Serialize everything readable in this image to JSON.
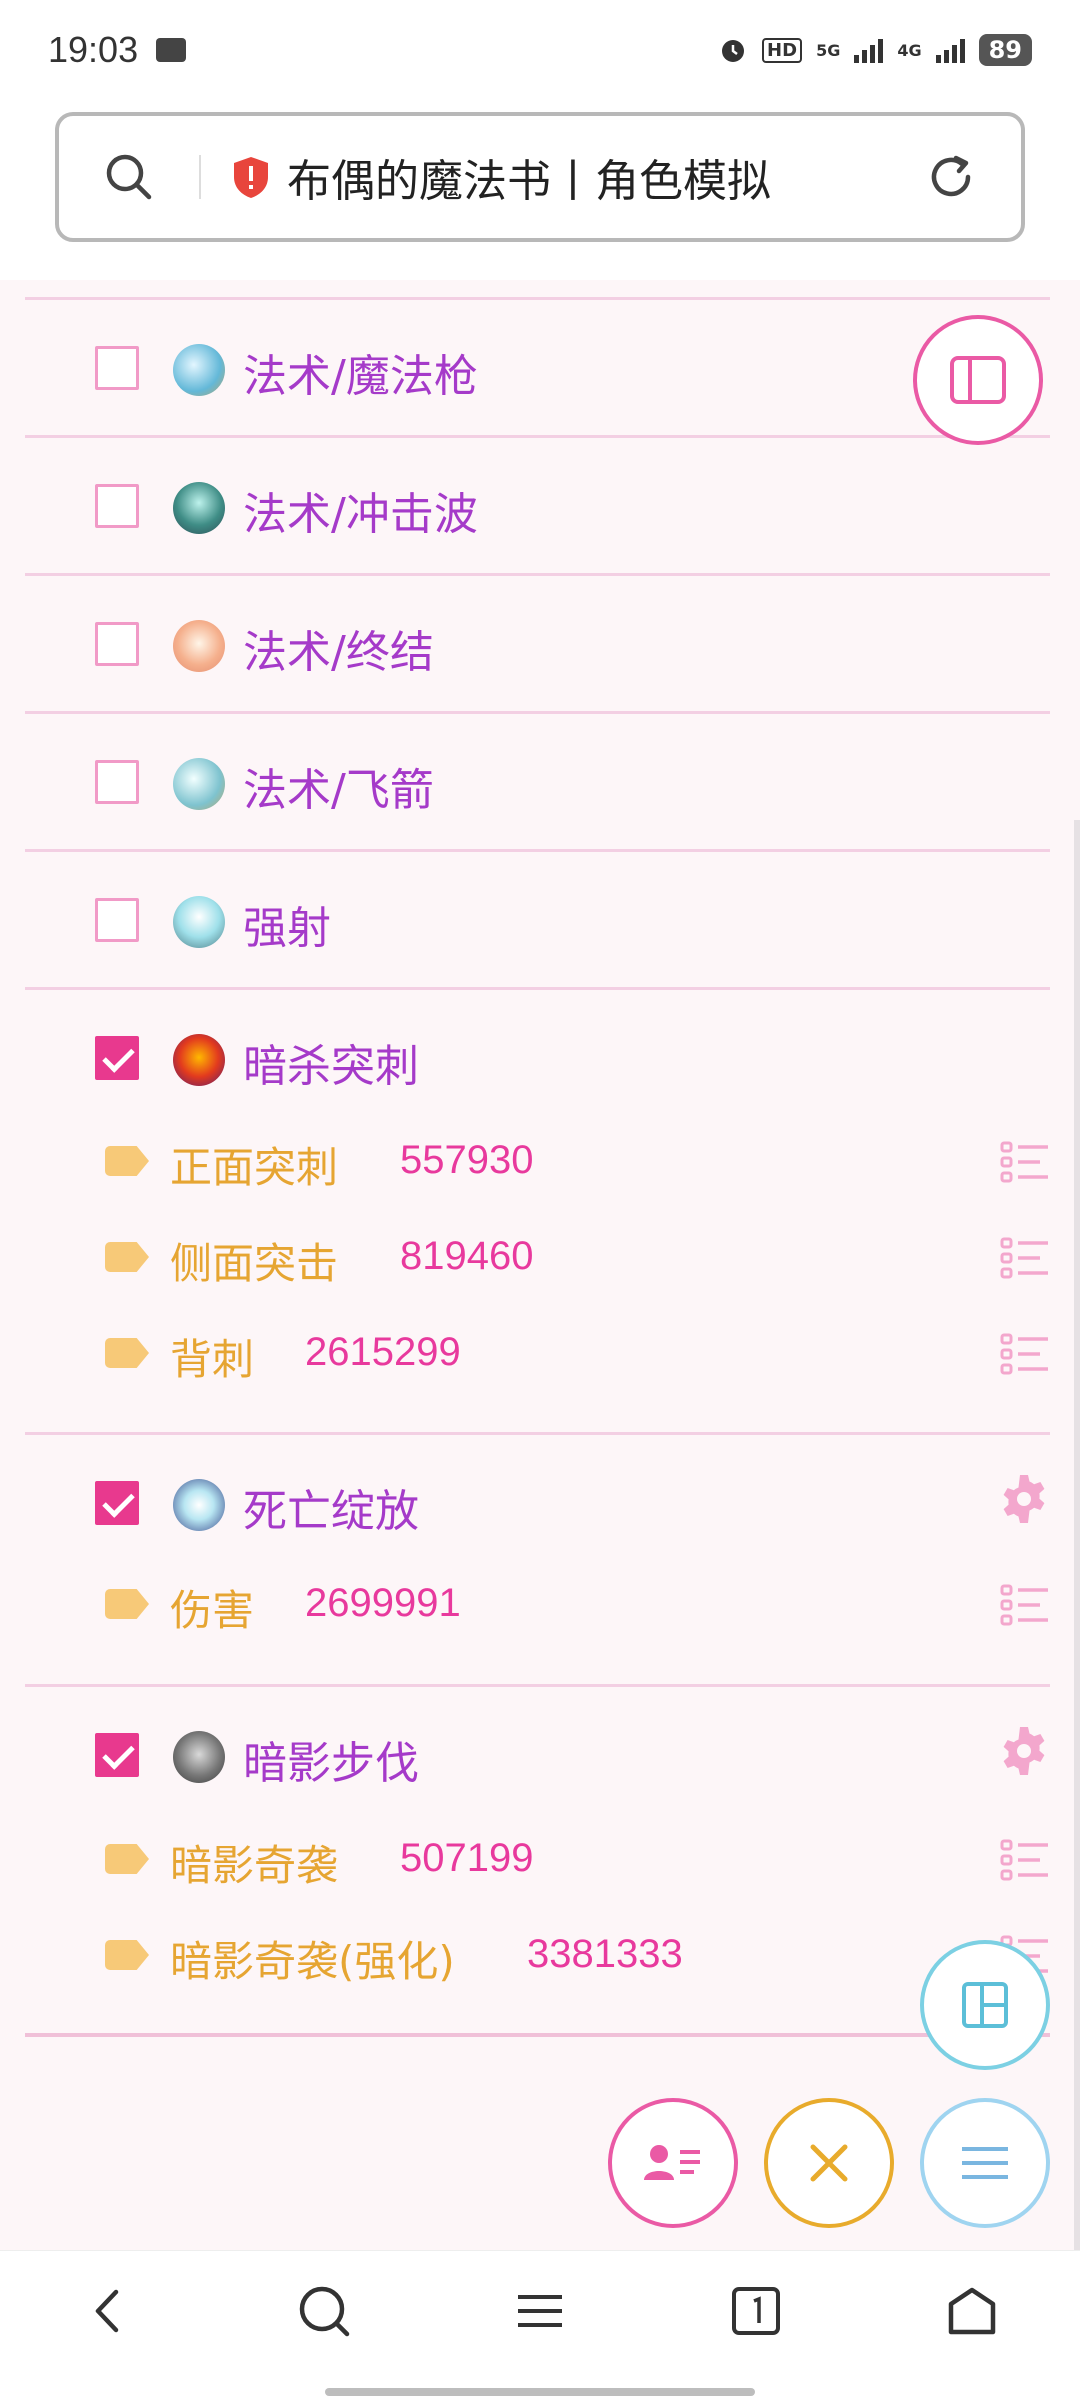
{
  "status_bar": {
    "time": "19:03",
    "hd": "HD",
    "net1": "5G",
    "net2": "4G",
    "battery": "89"
  },
  "address_bar": {
    "title": "布偶的魔法书丨角色模拟"
  },
  "colors": {
    "accent_pink": "#e8398e",
    "skill_purple": "#a53ac9",
    "sub_orange": "#e6a532",
    "value_pink": "#e8399d",
    "separator": "#f3cfe3"
  },
  "skills": [
    {
      "name": "法术/魔法枪",
      "checked": false,
      "icon": "magic-gun-icon"
    },
    {
      "name": "法术/冲击波",
      "checked": false,
      "icon": "shockwave-icon"
    },
    {
      "name": "法术/终结",
      "checked": false,
      "icon": "finisher-icon"
    },
    {
      "name": "法术/飞箭",
      "checked": false,
      "icon": "flying-arrow-icon"
    },
    {
      "name": "强射",
      "checked": false,
      "icon": "power-shot-icon"
    },
    {
      "name": "暗杀突刺",
      "checked": true,
      "icon": "assassinate-thrust-icon",
      "subs": [
        {
          "label": "正面突刺",
          "value": "557930"
        },
        {
          "label": "侧面突击",
          "value": "819460"
        },
        {
          "label": "背刺",
          "value": "2615299"
        }
      ]
    },
    {
      "name": "死亡绽放",
      "checked": true,
      "icon": "death-bloom-icon",
      "has_settings": true,
      "subs": [
        {
          "label": "伤害",
          "value": "2699991"
        }
      ]
    },
    {
      "name": "暗影步伐",
      "checked": true,
      "icon": "shadow-step-icon",
      "has_settings": true,
      "subs": [
        {
          "label": "暗影奇袭",
          "value": "507199"
        },
        {
          "label": "暗影奇袭(强化)",
          "value": "3381333"
        }
      ]
    }
  ]
}
